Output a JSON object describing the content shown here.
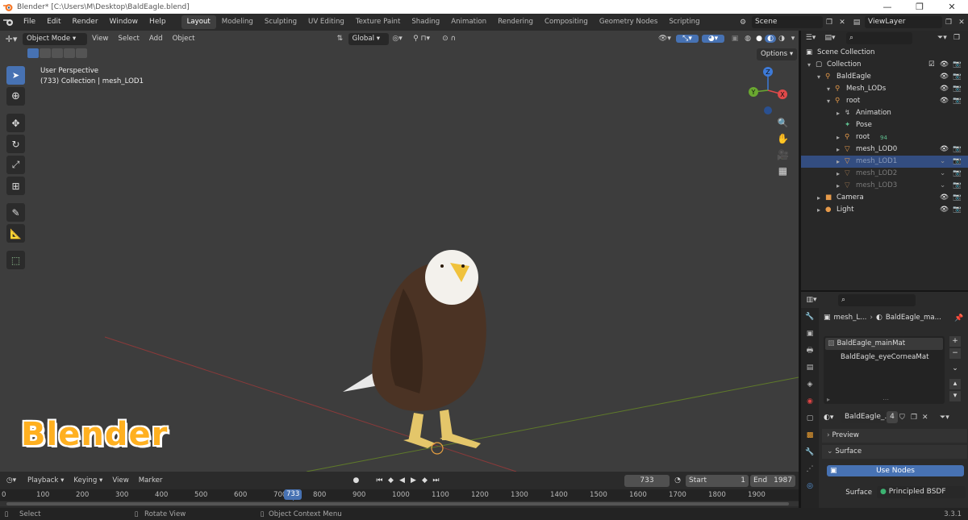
{
  "window": {
    "title": "Blender* [C:\\Users\\M\\Desktop\\BaldEagle.blend]",
    "minimize": "—",
    "maximize": "❐",
    "close": "✕"
  },
  "menus": [
    "File",
    "Edit",
    "Render",
    "Window",
    "Help"
  ],
  "workspaces": [
    "Layout",
    "Modeling",
    "Sculpting",
    "UV Editing",
    "Texture Paint",
    "Shading",
    "Animation",
    "Rendering",
    "Compositing",
    "Geometry Nodes",
    "Scripting"
  ],
  "scene": {
    "name": "Scene",
    "view_layer": "ViewLayer"
  },
  "viewport": {
    "mode": "Object Mode",
    "menus": [
      "View",
      "Select",
      "Add",
      "Object"
    ],
    "transform_orientation": "Global",
    "options_label": "Options",
    "info_line1": "User Perspective",
    "info_line2": "(733) Collection | mesh_LOD1",
    "gizmo": {
      "z": "Z",
      "y": "Y",
      "x": "X"
    },
    "watermark": "Blender"
  },
  "timeline": {
    "menus": [
      "Playback",
      "Keying",
      "View",
      "Marker"
    ],
    "current_frame": "733",
    "start_label": "Start",
    "start": "1",
    "end_label": "End",
    "end": "1987",
    "ticks": [
      "0",
      "100",
      "200",
      "300",
      "400",
      "500",
      "600",
      "700",
      "800",
      "900",
      "1000",
      "1100",
      "1200",
      "1300",
      "1400",
      "1500",
      "1600",
      "1700",
      "1800",
      "1900"
    ]
  },
  "statusbar": {
    "select": "Select",
    "rotate": "Rotate View",
    "context": "Object Context Menu",
    "version": "3.3.1"
  },
  "outliner": {
    "rows": [
      {
        "label": "Scene Collection",
        "indent": 0,
        "type": "scene"
      },
      {
        "label": "Collection",
        "indent": 1,
        "type": "collection"
      },
      {
        "label": "BaldEagle",
        "indent": 2,
        "type": "armature"
      },
      {
        "label": "Mesh_LODs",
        "indent": 3,
        "type": "armature"
      },
      {
        "label": "root",
        "indent": 3,
        "type": "armature"
      },
      {
        "label": "Animation",
        "indent": 4,
        "type": "anim"
      },
      {
        "label": "Pose",
        "indent": 4,
        "type": "pose"
      },
      {
        "label": "root",
        "indent": 4,
        "type": "armature",
        "badge": "94"
      },
      {
        "label": "mesh_LOD0",
        "indent": 4,
        "type": "mesh"
      },
      {
        "label": "mesh_LOD1",
        "indent": 4,
        "type": "mesh",
        "selected": true
      },
      {
        "label": "mesh_LOD2",
        "indent": 4,
        "type": "mesh",
        "dim": true
      },
      {
        "label": "mesh_LOD3",
        "indent": 4,
        "type": "mesh",
        "dim": true
      },
      {
        "label": "Camera",
        "indent": 2,
        "type": "camera"
      },
      {
        "label": "Light",
        "indent": 2,
        "type": "light"
      }
    ]
  },
  "properties": {
    "breadcrumb_object": "mesh_L...",
    "breadcrumb_material": "BaldEagle_ma...",
    "materials": [
      "BaldEagle_mainMat",
      "BaldEagle_eyeCorneaMat"
    ],
    "material_name": "BaldEagle_...",
    "users": "4",
    "panels": {
      "preview": "Preview",
      "surface": "Surface"
    },
    "use_nodes": "Use Nodes",
    "surface_label": "Surface",
    "surface_value": "Principled BSDF"
  },
  "colors": {
    "accent": "#4772b3",
    "selected_row": "#334d80",
    "brand": "#ffaa00"
  }
}
